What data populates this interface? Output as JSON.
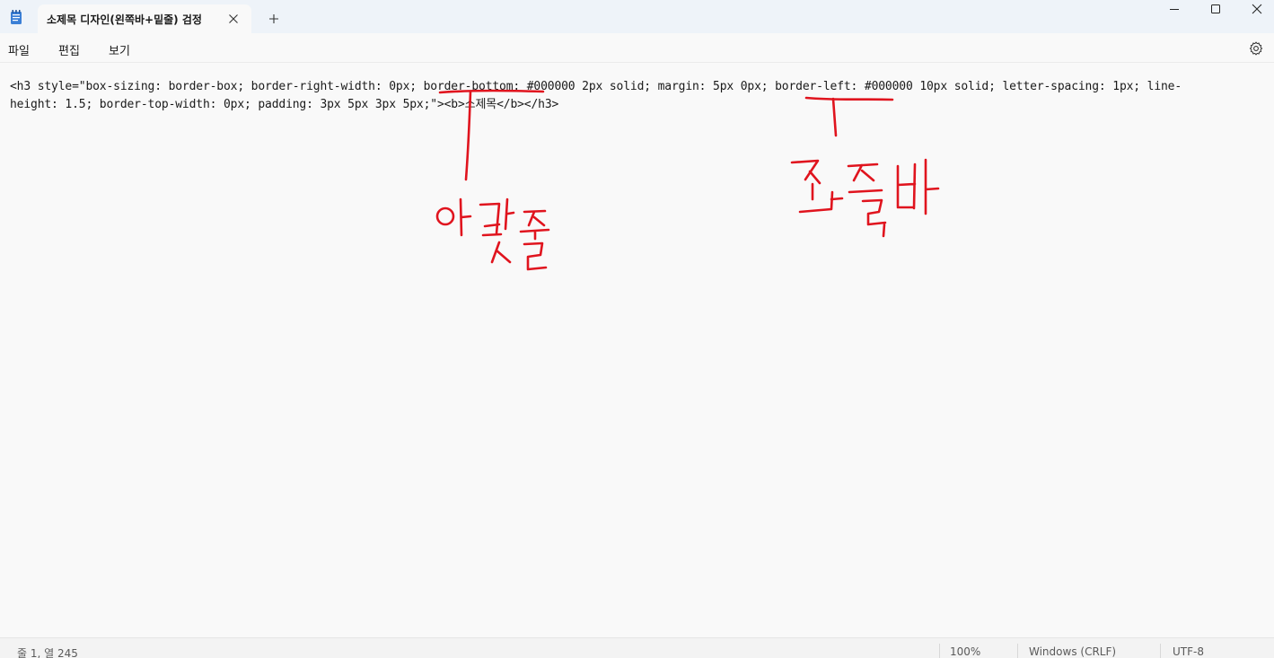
{
  "titlebar": {
    "app_icon": "notepad-icon",
    "tab_title": "소제목 디자인(왼쪽바+밑줄) 검정",
    "close_icon": "close-icon",
    "new_tab_icon": "plus-icon",
    "window_controls": [
      "minimize-icon",
      "maximize-icon",
      "close-icon"
    ]
  },
  "menu": {
    "file": "파일",
    "edit": "편집",
    "view": "보기",
    "settings_icon": "gear-icon"
  },
  "editor": {
    "line1": "<h3 style=\"box-sizing: border-box; border-right-width: 0px; border-bottom: #000000 2px solid; margin: 5px 0px; border-left: #000000 10px solid; letter-spacing: 1px; line-",
    "line2": "height: 1.5; border-top-width: 0px; padding: 3px 5px 3px 5px;\"><b>소제목</b></h3>"
  },
  "annotations": {
    "color": "#e0141e",
    "bottom_note": "아랫줄",
    "left_note": "좌측바"
  },
  "status": {
    "position": "줄 1, 열 245",
    "zoom": "100%",
    "line_ending": "Windows (CRLF)",
    "encoding": "UTF-8"
  }
}
